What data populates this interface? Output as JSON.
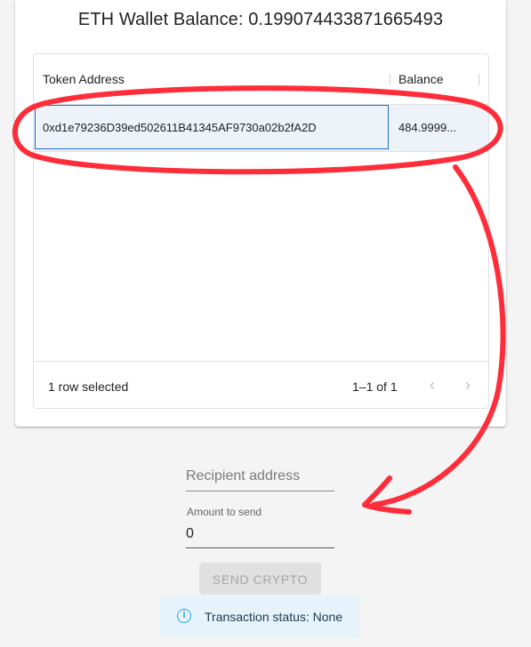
{
  "header": {
    "title": "ETH Wallet Balance: 0.199074433871665493"
  },
  "table": {
    "columns": [
      "Token Address",
      "Balance"
    ],
    "rows": [
      {
        "address": "0xd1e79236D39ed502611B41345AF9730a02b2fA2D",
        "balance": "484.9999..."
      }
    ],
    "footer": {
      "selected": "1 row selected",
      "pagination": "1–1 of 1",
      "prev_icon": "chevron-left-icon",
      "next_icon": "chevron-right-icon"
    }
  },
  "form": {
    "recipient_placeholder": "Recipient address",
    "amount_label": "Amount to send",
    "amount_value": "0",
    "send_label": "SEND CRYPTO"
  },
  "status": {
    "icon": "info-icon",
    "text": "Transaction status: None"
  },
  "annotation": {
    "color": "#ff2d3a"
  }
}
